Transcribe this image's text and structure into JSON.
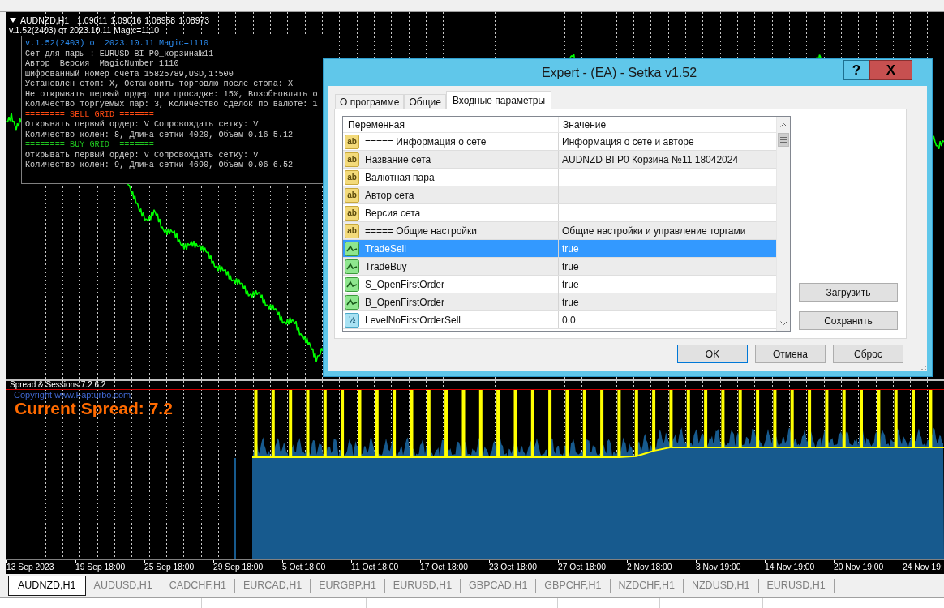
{
  "chart": {
    "symbol": "AUDNZD,H1",
    "prices": [
      "1.09011",
      "1.09016",
      "1.08958",
      "1.08973"
    ],
    "ea_label": "v.1.52(2403) от 2023.10.11 Magic=1110",
    "info_panel": [
      {
        "kind": "title",
        "text": "v.1.52(2403) от 2023.10.11 Magic=1110"
      },
      {
        "kind": "normal",
        "text": "Сет для пары : EURUSD BI P0_корзина№11"
      },
      {
        "kind": "normal",
        "text": "Автор  Версия  MagicNumber 1110"
      },
      {
        "kind": "normal",
        "text": "Шифрованный номер счета 15825789,USD,1:500"
      },
      {
        "kind": "normal",
        "text": "Установлен стоп: X, Остановить торговлю после стопа: X"
      },
      {
        "kind": "normal",
        "text": "Не открывать первый ордер при просадке: 15%, Возобновлять о"
      },
      {
        "kind": "normal",
        "text": "Количество торгуемых пар: 3, Количество сделок по валюте: 1"
      },
      {
        "kind": "sell",
        "text": "======== SELL GRID ======="
      },
      {
        "kind": "normal",
        "text": "Открывать первый ордер: V Сопровождать сетку: V"
      },
      {
        "kind": "normal",
        "text": "Количество колен: 8, Длина сетки 4020, Объем 0.16-5.12"
      },
      {
        "kind": "buy",
        "text": "======== BUY GRID  ======="
      },
      {
        "kind": "normal",
        "text": "Открывать первый ордер: V Сопровождать сетку: V"
      },
      {
        "kind": "normal",
        "text": "Количество колен: 9, Длина сетки 4690, Объем 0.06-6.52"
      }
    ]
  },
  "indicator": {
    "name": "Spread & Sessions 7.2 6.2",
    "copyright": "Copyright www.Fapturbo.com",
    "current_spread": "Current Spread: 7.2"
  },
  "time_axis": [
    "13 Sep 2023",
    "19 Sep 18:00",
    "25 Sep 18:00",
    "29 Sep 18:00",
    "5 Oct 18:00",
    "11 Oct 18:00",
    "17 Oct 18:00",
    "23 Oct 18:00",
    "27 Oct 18:00",
    "2 Nov 18:00",
    "8 Nov 19:00",
    "14 Nov 19:00",
    "20 Nov 19:00",
    "24 Nov 19:"
  ],
  "chart_tabs": [
    {
      "label": "AUDNZD,H1",
      "selected": true
    },
    {
      "label": "AUDUSD,H1",
      "selected": false
    },
    {
      "label": "CADCHF,H1",
      "selected": false
    },
    {
      "label": "EURCAD,H1",
      "selected": false
    },
    {
      "label": "EURGBP,H1",
      "selected": false
    },
    {
      "label": "EURUSD,H1",
      "selected": false
    },
    {
      "label": "GBPCAD,H1",
      "selected": false
    },
    {
      "label": "GBPCHF,H1",
      "selected": false
    },
    {
      "label": "NZDCHF,H1",
      "selected": false
    },
    {
      "label": "NZDUSD,H1",
      "selected": false
    },
    {
      "label": "EURUSD,H1",
      "selected": false
    }
  ],
  "dialog": {
    "title": "Expert - (EA) - Setka v1.52",
    "help_button": "?",
    "close_button": "X",
    "tabs": [
      {
        "label": "О программе",
        "selected": false
      },
      {
        "label": "Общие",
        "selected": false
      },
      {
        "label": "Входные параметры",
        "selected": true
      }
    ],
    "table": {
      "columns": [
        "Переменная",
        "Значение"
      ],
      "rows": [
        {
          "kind": "string",
          "type_label": "ab",
          "name": "===== Информация о сете",
          "value": "Информация о сете и авторе",
          "selected": false
        },
        {
          "kind": "string",
          "type_label": "ab",
          "name": "Название сета",
          "value": "AUDNZD BI P0 Корзина №11 18042024",
          "selected": false
        },
        {
          "kind": "string",
          "type_label": "ab",
          "name": "Валютная пара",
          "selected": false
        },
        {
          "kind": "string",
          "type_label": "ab",
          "name": "Автор сета",
          "selected": false
        },
        {
          "kind": "string",
          "type_label": "ab",
          "name": "Версия сета",
          "selected": false
        },
        {
          "kind": "string",
          "type_label": "ab",
          "name": "===== Общие настройки",
          "value": "Общие настройки и управление торгами",
          "selected": false
        },
        {
          "kind": "bool",
          "name": "TradeSell",
          "value": "true",
          "selected": true
        },
        {
          "kind": "bool",
          "name": "TradeBuy",
          "value": "true",
          "selected": false
        },
        {
          "kind": "bool",
          "name": "S_OpenFirstOrder",
          "value": "true",
          "selected": false
        },
        {
          "kind": "bool",
          "name": "B_OpenFirstOrder",
          "value": "true",
          "selected": false
        },
        {
          "kind": "double",
          "type_label": "½",
          "name": "LevelNoFirstOrderSell",
          "value": "0.0",
          "selected": false
        }
      ]
    },
    "side_buttons": [
      "Загрузить",
      "Сохранить"
    ],
    "buttons": [
      {
        "label": "OK",
        "default": true
      },
      {
        "label": "Отмена",
        "default": false
      },
      {
        "label": "Сброс",
        "default": false
      }
    ]
  }
}
